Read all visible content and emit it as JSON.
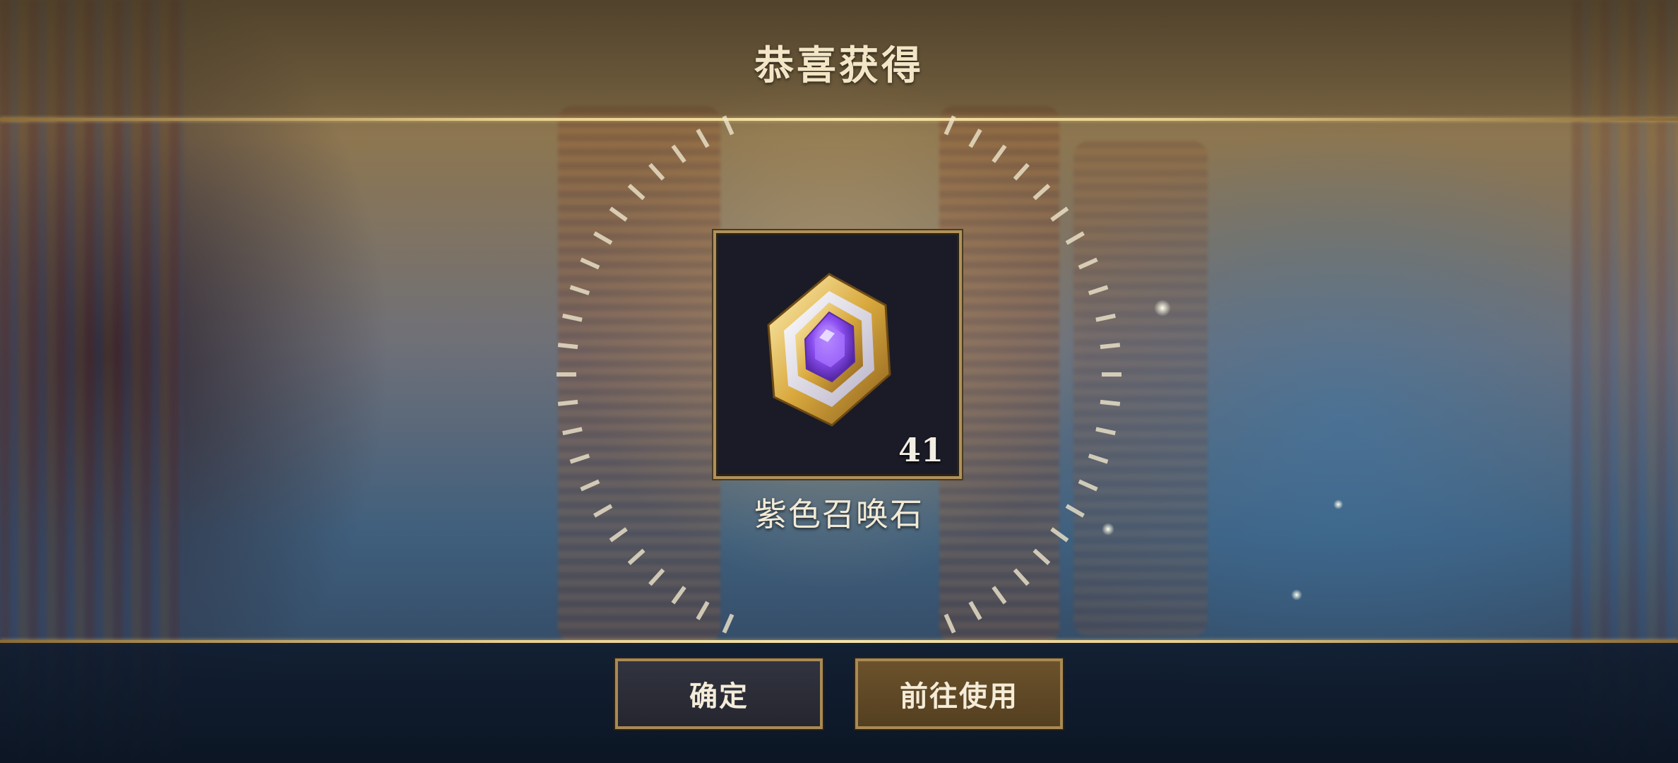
{
  "header": {
    "title": "恭喜获得"
  },
  "reward": {
    "icon": "purple-summon-stone-icon",
    "count": "41",
    "name": "紫色召唤石"
  },
  "actions": {
    "confirm_label": "确定",
    "use_label": "前往使用"
  },
  "colors": {
    "gold_accent": "#e8cf8e",
    "gem_purple": "#7a3fe0",
    "confirm_button_bg": "#2c2e39",
    "use_button_bg": "#5f4826"
  }
}
